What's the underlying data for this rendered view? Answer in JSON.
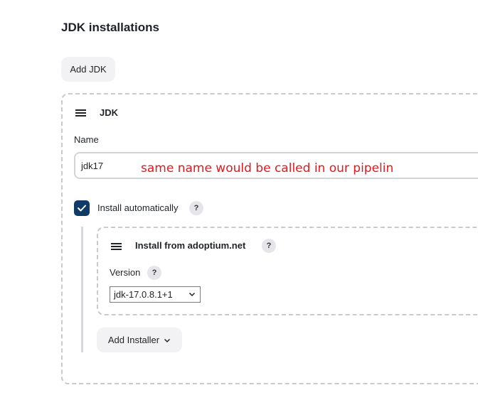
{
  "section": {
    "title": "JDK installations"
  },
  "buttons": {
    "add_jdk": "Add JDK",
    "add_installer": "Add Installer"
  },
  "jdk": {
    "heading": "JDK",
    "name_label": "Name",
    "name_value": "jdk17",
    "annotation": "same name would be called in our pipeline",
    "install_auto_label": "Install automatically",
    "install_auto_checked": true
  },
  "installer": {
    "heading": "Install from adoptium.net",
    "version_label": "Version",
    "version_selected": "jdk-17.0.8.1+1"
  },
  "help_glyph": "?",
  "icons": [
    "drag-handle-icon",
    "checkmark-icon",
    "help-icon",
    "chevron-down-icon"
  ]
}
